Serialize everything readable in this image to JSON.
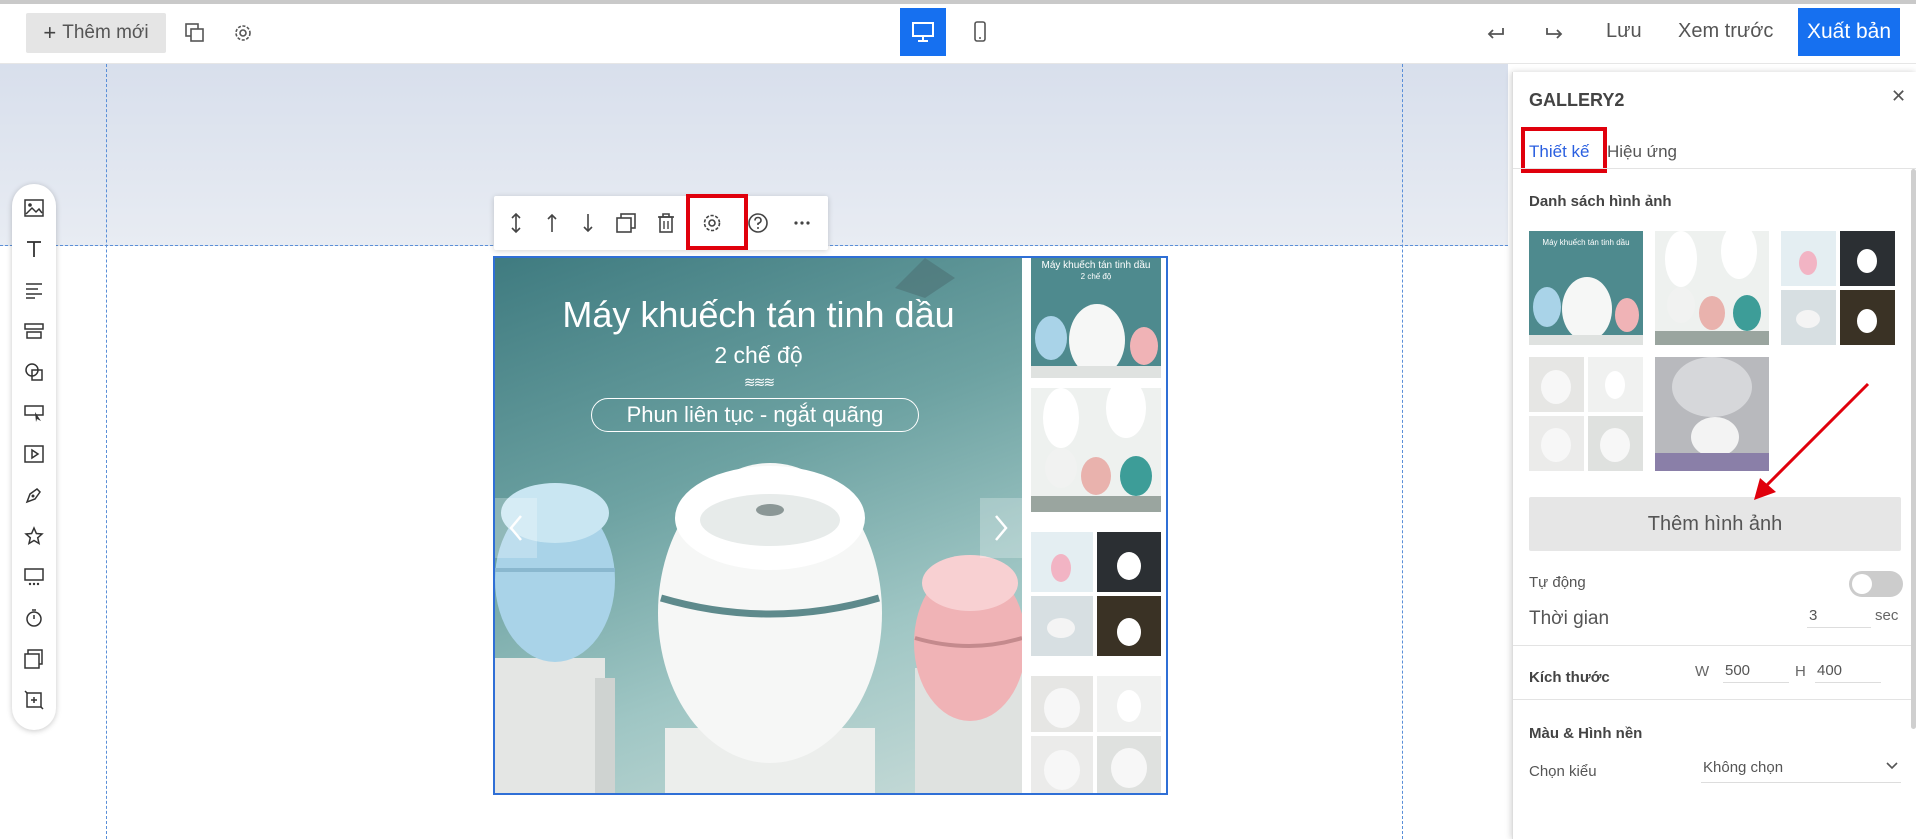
{
  "topbar": {
    "add_new_label": "Thêm mới",
    "save_label": "Lưu",
    "preview_label": "Xem trước",
    "publish_label": "Xuất bản"
  },
  "gallery": {
    "main_title": "Máy khuếch tán tinh dầu",
    "main_subtitle": "2 chế độ",
    "main_pill": "Phun liên tục - ngắt quãng",
    "thumb1_title": "Máy khuếch tán tinh dầu",
    "thumb1_sub": "2 chế độ"
  },
  "panel": {
    "title": "GALLERY2",
    "tab_design": "Thiết kế",
    "tab_effect": "Hiệu ứng",
    "images_section": "Danh sách hình ảnh",
    "add_image_button": "Thêm hình ảnh",
    "auto_label": "Tự động",
    "auto_enabled": false,
    "time_label": "Thời gian",
    "time_value": "3",
    "time_unit": "sec",
    "size_label": "Kích thước",
    "width_prefix": "W",
    "width_value": "500",
    "height_prefix": "H",
    "height_value": "400",
    "color_bg_section": "Màu & Hình nền",
    "style_label": "Chọn kiểu",
    "style_value": "Không chọn"
  },
  "colors": {
    "accent_blue": "#1670f0",
    "highlight_red": "#e0000c"
  }
}
